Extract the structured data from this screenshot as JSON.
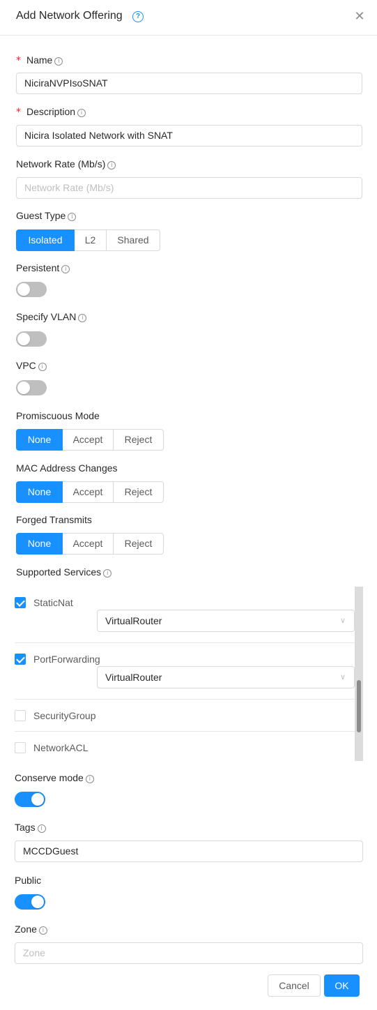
{
  "dialog": {
    "title": "Add Network Offering",
    "help_icon": "question-circle-icon",
    "close_icon": "close-icon"
  },
  "form": {
    "name": {
      "label": "Name",
      "required": true,
      "value": "NiciraNVPIsoSNAT"
    },
    "description": {
      "label": "Description",
      "required": true,
      "value": "Nicira Isolated Network with SNAT"
    },
    "network_rate": {
      "label": "Network Rate (Mb/s)",
      "placeholder": "Network Rate (Mb/s)"
    },
    "guest_type": {
      "label": "Guest Type",
      "options": [
        "Isolated",
        "L2",
        "Shared"
      ],
      "selected": "Isolated"
    },
    "persistent": {
      "label": "Persistent",
      "on": false
    },
    "specify_vlan": {
      "label": "Specify VLAN",
      "on": false
    },
    "vpc": {
      "label": "VPC",
      "on": false
    },
    "promiscuous_mode": {
      "label": "Promiscuous Mode",
      "options": [
        "None",
        "Accept",
        "Reject"
      ],
      "selected": "None"
    },
    "mac_address_changes": {
      "label": "MAC Address Changes",
      "options": [
        "None",
        "Accept",
        "Reject"
      ],
      "selected": "None"
    },
    "forged_transmits": {
      "label": "Forged Transmits",
      "options": [
        "None",
        "Accept",
        "Reject"
      ],
      "selected": "None"
    },
    "supported_services": {
      "label": "Supported Services",
      "items": [
        {
          "name": "StaticNat",
          "checked": true,
          "provider": "VirtualRouter"
        },
        {
          "name": "PortForwarding",
          "checked": true,
          "provider": "VirtualRouter"
        },
        {
          "name": "SecurityGroup",
          "checked": false
        },
        {
          "name": "NetworkACL",
          "checked": false
        }
      ]
    },
    "conserve_mode": {
      "label": "Conserve mode",
      "on": true
    },
    "tags": {
      "label": "Tags",
      "value": "MCCDGuest"
    },
    "public": {
      "label": "Public",
      "on": true
    },
    "zone": {
      "label": "Zone",
      "placeholder": "Zone"
    }
  },
  "footer": {
    "cancel_label": "Cancel",
    "ok_label": "OK"
  },
  "colors": {
    "primary": "#1890ff",
    "required": "#f5222d",
    "border": "#d9d9d9"
  }
}
